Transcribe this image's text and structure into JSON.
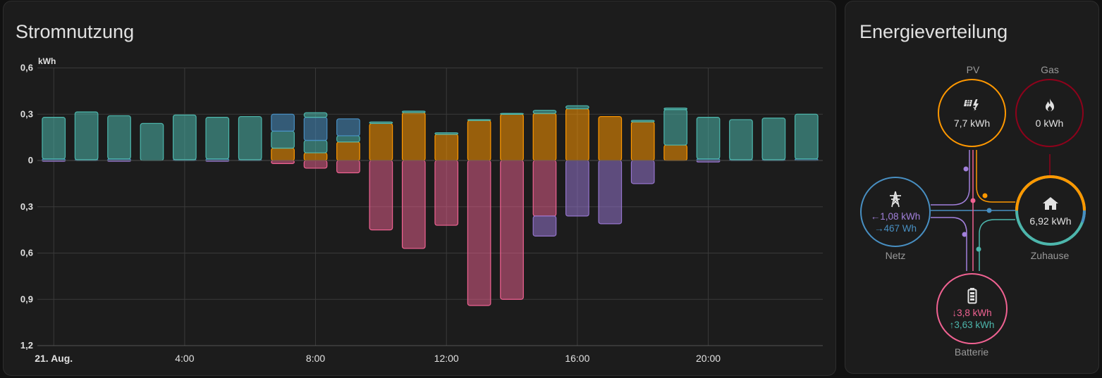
{
  "usage_card": {
    "title": "Stromnutzung",
    "unit": "kWh"
  },
  "chart_data": {
    "type": "bar",
    "stacked": true,
    "y_axis": {
      "label": "kWh",
      "tick_labels": [
        "0,6",
        "0,3",
        "0",
        "0,3",
        "0,6",
        "0,9",
        "1,2"
      ],
      "range": [
        -1.2,
        0.6
      ]
    },
    "x_axis": {
      "tick_labels": [
        "21. Aug.",
        "4:00",
        "8:00",
        "12:00",
        "16:00",
        "20:00"
      ],
      "tick_hours": [
        0,
        4,
        8,
        12,
        16,
        20
      ]
    },
    "hours": [
      0,
      1,
      2,
      3,
      4,
      5,
      6,
      7,
      8,
      9,
      10,
      11,
      12,
      13,
      14,
      15,
      16,
      17,
      18,
      19,
      20,
      21,
      22,
      23
    ],
    "series": [
      {
        "key": "grid_in",
        "color": "#488fc2",
        "values": [
          0.01,
          0.005,
          0.01,
          0,
          0.005,
          0.01,
          0.005,
          0,
          0,
          0,
          0,
          0,
          0,
          0,
          0,
          0,
          0,
          0,
          0,
          0,
          0.01,
          0.005,
          0.005,
          0.01
        ]
      },
      {
        "key": "solar",
        "color": "#ff9800",
        "values": [
          0,
          0,
          0,
          0,
          0,
          0,
          0,
          0.08,
          0.05,
          0.12,
          0.24,
          0.31,
          0.17,
          0.26,
          0.3,
          0.305,
          0.335,
          0.285,
          0.25,
          0.1,
          0,
          0,
          0,
          0
        ]
      },
      {
        "key": "battery_in",
        "color": "#4db6ac",
        "values": [
          0.27,
          0.31,
          0.28,
          0.24,
          0.29,
          0.27,
          0.28,
          0.11,
          0.08,
          0.04,
          0.01,
          0.01,
          0.01,
          0.005,
          0.005,
          0.02,
          0.02,
          0,
          0.01,
          0.23,
          0.27,
          0.26,
          0.27,
          0.29
        ]
      },
      {
        "key": "grid_from_battery",
        "color": "#488fc2",
        "values": [
          0,
          0,
          0,
          0,
          0,
          0,
          0,
          0.11,
          0.15,
          0.11,
          0,
          0,
          0,
          0,
          0,
          0,
          0,
          0,
          0,
          0,
          0,
          0,
          0,
          0
        ]
      },
      {
        "key": "solar_to_battery",
        "color": "#4db6ac",
        "values": [
          0,
          0,
          0,
          0,
          0,
          0,
          0,
          0,
          0.03,
          0,
          0,
          0,
          0,
          0,
          0,
          0,
          0,
          0,
          0,
          0.01,
          0,
          0,
          0,
          0
        ]
      },
      {
        "key": "to_battery",
        "color": "#f06292",
        "values": [
          0,
          0,
          0,
          0,
          0,
          0,
          0,
          -0.02,
          -0.05,
          -0.08,
          -0.45,
          -0.57,
          -0.42,
          -0.94,
          -0.9,
          -0.36,
          0,
          0,
          0,
          0,
          0,
          0,
          0,
          0
        ]
      },
      {
        "key": "to_grid",
        "color": "#9575cd",
        "values": [
          -0.005,
          0,
          -0.005,
          0,
          0,
          -0.005,
          0,
          0,
          0,
          0,
          0,
          0,
          0,
          0,
          0,
          -0.13,
          -0.36,
          -0.41,
          -0.15,
          0,
          -0.01,
          0,
          0,
          0
        ]
      }
    ]
  },
  "flow_card": {
    "title": "Energieverteilung",
    "pv": {
      "label": "PV",
      "value": "7,7 kWh",
      "icon": "solar-panel-icon",
      "color": "#ff9800"
    },
    "gas": {
      "label": "Gas",
      "value": "0 kWh",
      "icon": "fire-icon",
      "color": "#8e021b"
    },
    "grid": {
      "label": "Netz",
      "from": "1,08 kWh",
      "to": "467 Wh",
      "from_arrow": "←",
      "to_arrow": "→",
      "icon": "transmission-tower-icon",
      "color": "#488fc2",
      "from_color": "#a280db",
      "to_color": "#488fc2"
    },
    "home": {
      "label": "Zuhause",
      "value": "6,92 kWh",
      "icon": "home-icon",
      "color": "#4db6ac"
    },
    "battery": {
      "label": "Batterie",
      "out": "3,8 kWh",
      "in": "3,63 kWh",
      "out_arrow": "↓",
      "in_arrow": "↑",
      "icon": "battery-icon",
      "color": "#f06292",
      "out_color": "#f06292",
      "in_color": "#4db6ac"
    }
  }
}
